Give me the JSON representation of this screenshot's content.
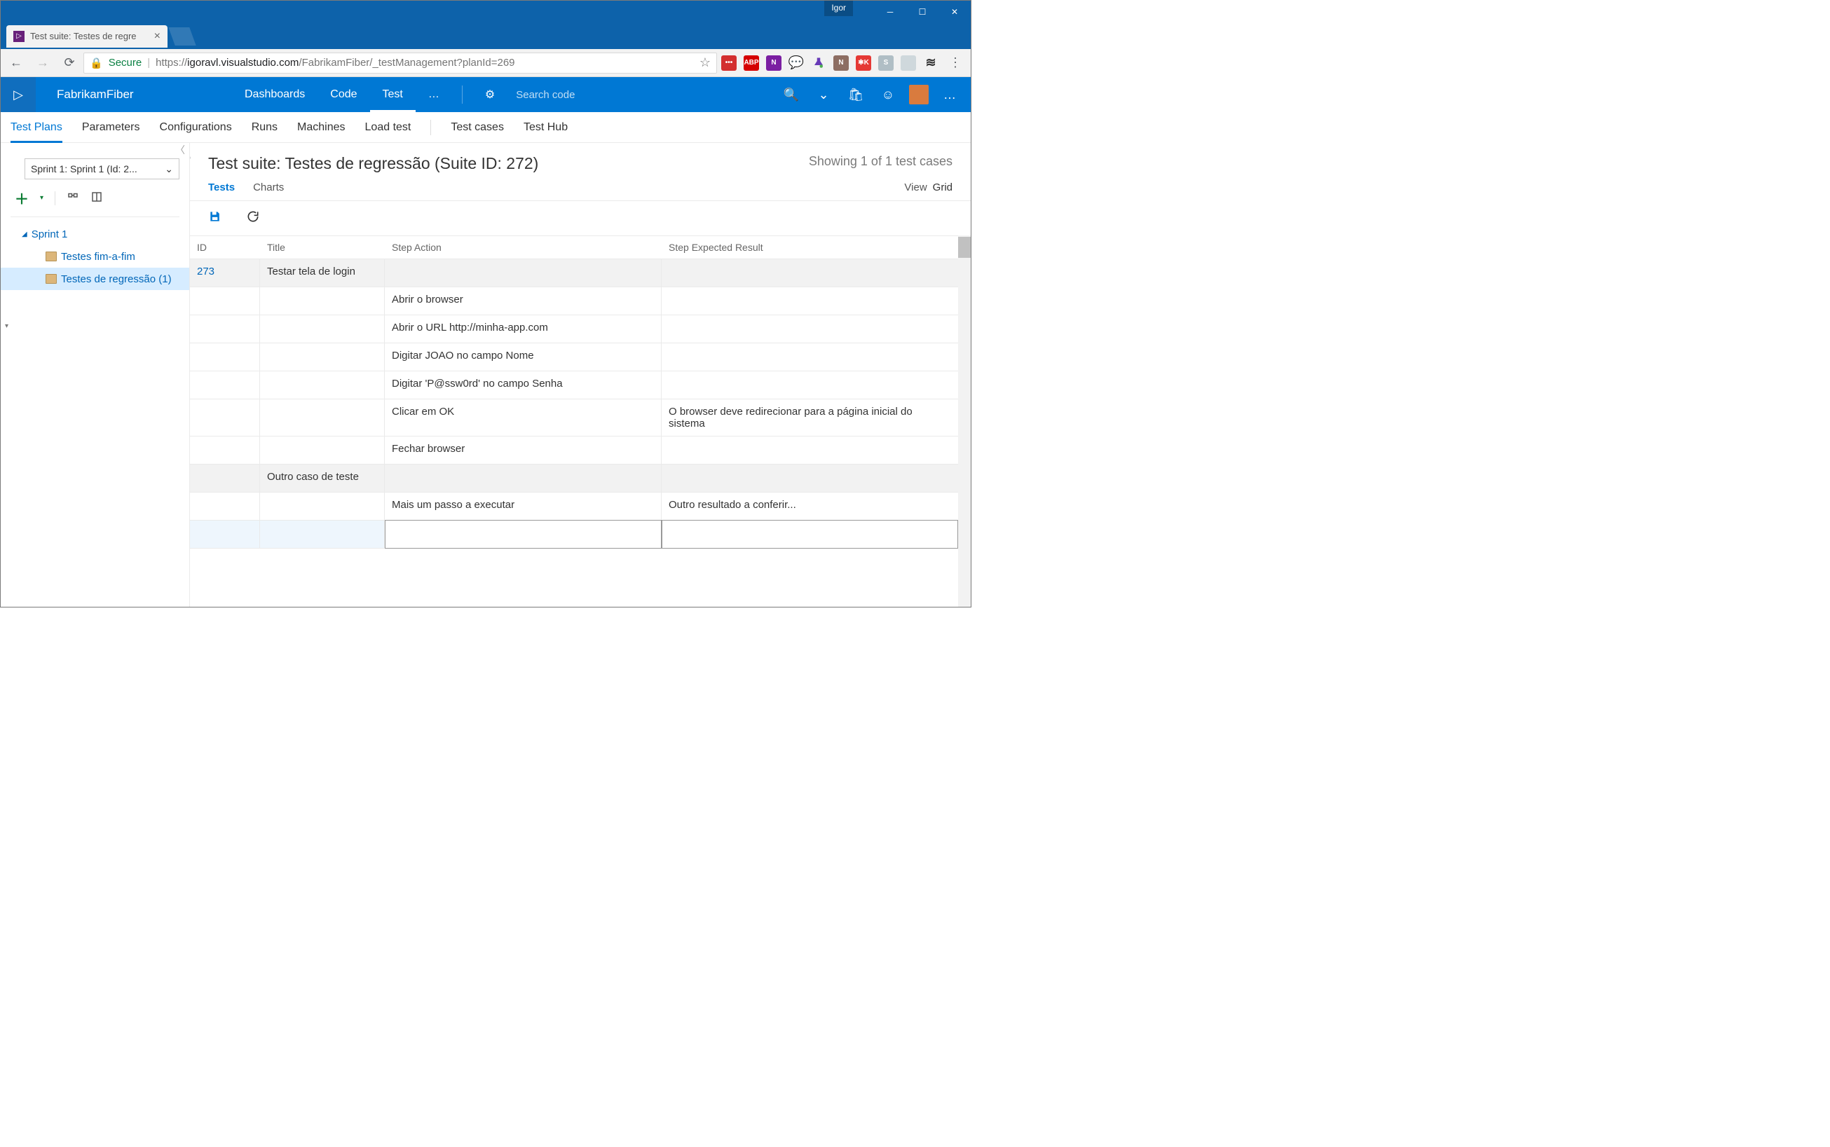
{
  "window": {
    "user_badge": "Igor"
  },
  "browser": {
    "tab_title": "Test suite: Testes de regre",
    "secure_label": "Secure",
    "url_scheme": "https",
    "url_host": "igoravl.visualstudio.com",
    "url_path": "/FabrikamFiber/_testManagement?planId=269"
  },
  "vsts": {
    "project": "FabrikamFiber",
    "nav": {
      "dashboards": "Dashboards",
      "code": "Code",
      "test": "Test",
      "more": "…"
    },
    "search_placeholder": "Search code"
  },
  "hub": {
    "tabs": {
      "test_plans": "Test Plans",
      "parameters": "Parameters",
      "configurations": "Configurations",
      "runs": "Runs",
      "machines": "Machines",
      "load_test": "Load test",
      "test_cases": "Test cases",
      "test_hub": "Test Hub"
    }
  },
  "sidebar": {
    "sprint_selector": "Sprint 1: Sprint 1 (Id: 2...",
    "tree": {
      "root": "Sprint 1",
      "child1": "Testes fim-a-fim",
      "child2": "Testes de regressão (1)"
    }
  },
  "page": {
    "title": "Test suite: Testes de regressão (Suite ID: 272)",
    "count": "Showing 1 of 1 test cases",
    "pivot_tests": "Tests",
    "pivot_charts": "Charts",
    "view_label": "View",
    "view_value": "Grid"
  },
  "grid": {
    "headers": {
      "id": "ID",
      "title": "Title",
      "action": "Step Action",
      "expected": "Step Expected Result"
    },
    "rows": [
      {
        "id": "273",
        "title": "Testar tela de login",
        "action": "",
        "expected": "",
        "header": true
      },
      {
        "id": "",
        "title": "",
        "action": "Abrir o browser",
        "expected": ""
      },
      {
        "id": "",
        "title": "",
        "action": "Abrir o URL http://minha-app.com",
        "expected": ""
      },
      {
        "id": "",
        "title": "",
        "action": "Digitar JOAO no campo Nome",
        "expected": ""
      },
      {
        "id": "",
        "title": "",
        "action": "Digitar 'P@ssw0rd' no campo Senha",
        "expected": ""
      },
      {
        "id": "",
        "title": "",
        "action": "Clicar em OK",
        "expected": "O browser deve redirecionar para a página inicial do sistema"
      },
      {
        "id": "",
        "title": "",
        "action": "Fechar browser",
        "expected": ""
      },
      {
        "id": "",
        "title": "Outro caso de teste",
        "action": "",
        "expected": "",
        "header": true
      },
      {
        "id": "",
        "title": "",
        "action": "Mais um passo a executar",
        "expected": "Outro resultado a conferir..."
      },
      {
        "id": "",
        "title": "",
        "action": "",
        "expected": "",
        "empty_active": true
      }
    ]
  }
}
